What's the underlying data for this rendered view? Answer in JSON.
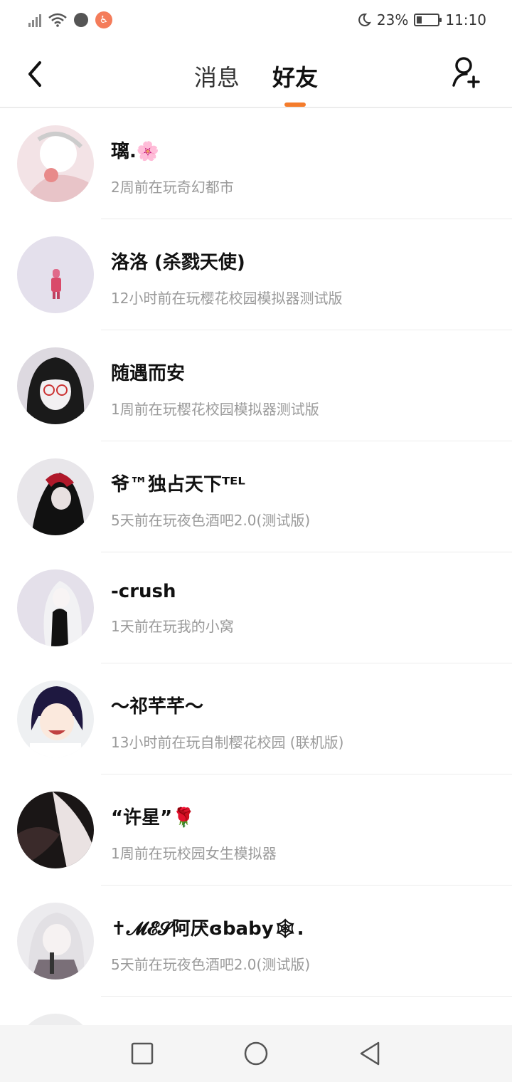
{
  "status_bar": {
    "battery": "23%",
    "time": "11:10"
  },
  "header": {
    "tabs": [
      {
        "label": "消息",
        "active": false
      },
      {
        "label": "好友",
        "active": true
      }
    ]
  },
  "accent_color": "#f47c2c",
  "friends": [
    {
      "name": "璃.🌸",
      "status": "2周前在玩奇幻都市"
    },
    {
      "name": "洛洛 (杀戮天使)",
      "status": "12小时前在玩樱花校园模拟器测试版"
    },
    {
      "name": "随遇而安",
      "status": "1周前在玩樱花校园模拟器测试版"
    },
    {
      "name": "爷™独占天下ᵀᴱᴸ",
      "status": "5天前在玩夜色酒吧2.0(测试版)"
    },
    {
      "name": "-crush",
      "status": "1天前在玩我的小窝"
    },
    {
      "name": "〜祁芊芊〜",
      "status": "13小时前在玩自制樱花校园 (联机版)"
    },
    {
      "name": "“许星”🌹",
      "status": "1周前在玩校园女生模拟器"
    },
    {
      "name": "✝𝓜𝓔𝓢阿厌ɞbaby🕸.",
      "status": "5天前在玩夜色酒吧2.0(测试版)"
    },
    {
      "name": "",
      "status": ""
    }
  ]
}
